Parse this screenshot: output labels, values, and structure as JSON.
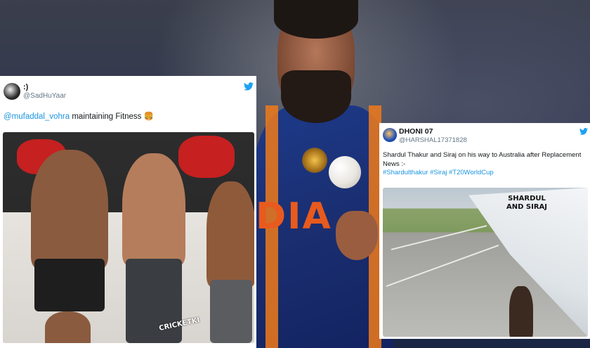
{
  "tweets": {
    "left": {
      "display_name": ":)",
      "handle": "@SadHuYaar",
      "mention": "@mufaddal_vohra",
      "text": " maintaining Fitness 🍔",
      "media_watermark": "CRICKETKI"
    },
    "right": {
      "display_name": "DHONI 07",
      "handle": "@HARSHAL17371828",
      "text": "Shardul Thakur and Siraj on his way to Australia after Replacement News :-",
      "hashtags": "#Shardulthakur #Siraj #T20WorldCup",
      "media_caption_line1": "SHARDUL",
      "media_caption_line2": "AND SIRAJ"
    }
  },
  "player": {
    "jersey_text": "DIA"
  },
  "colors": {
    "twitter_blue": "#1da1f2",
    "jersey_blue": "#1a2e70",
    "jersey_orange": "#e85a1d"
  },
  "icons": {
    "twitter": "twitter-bird-icon"
  }
}
